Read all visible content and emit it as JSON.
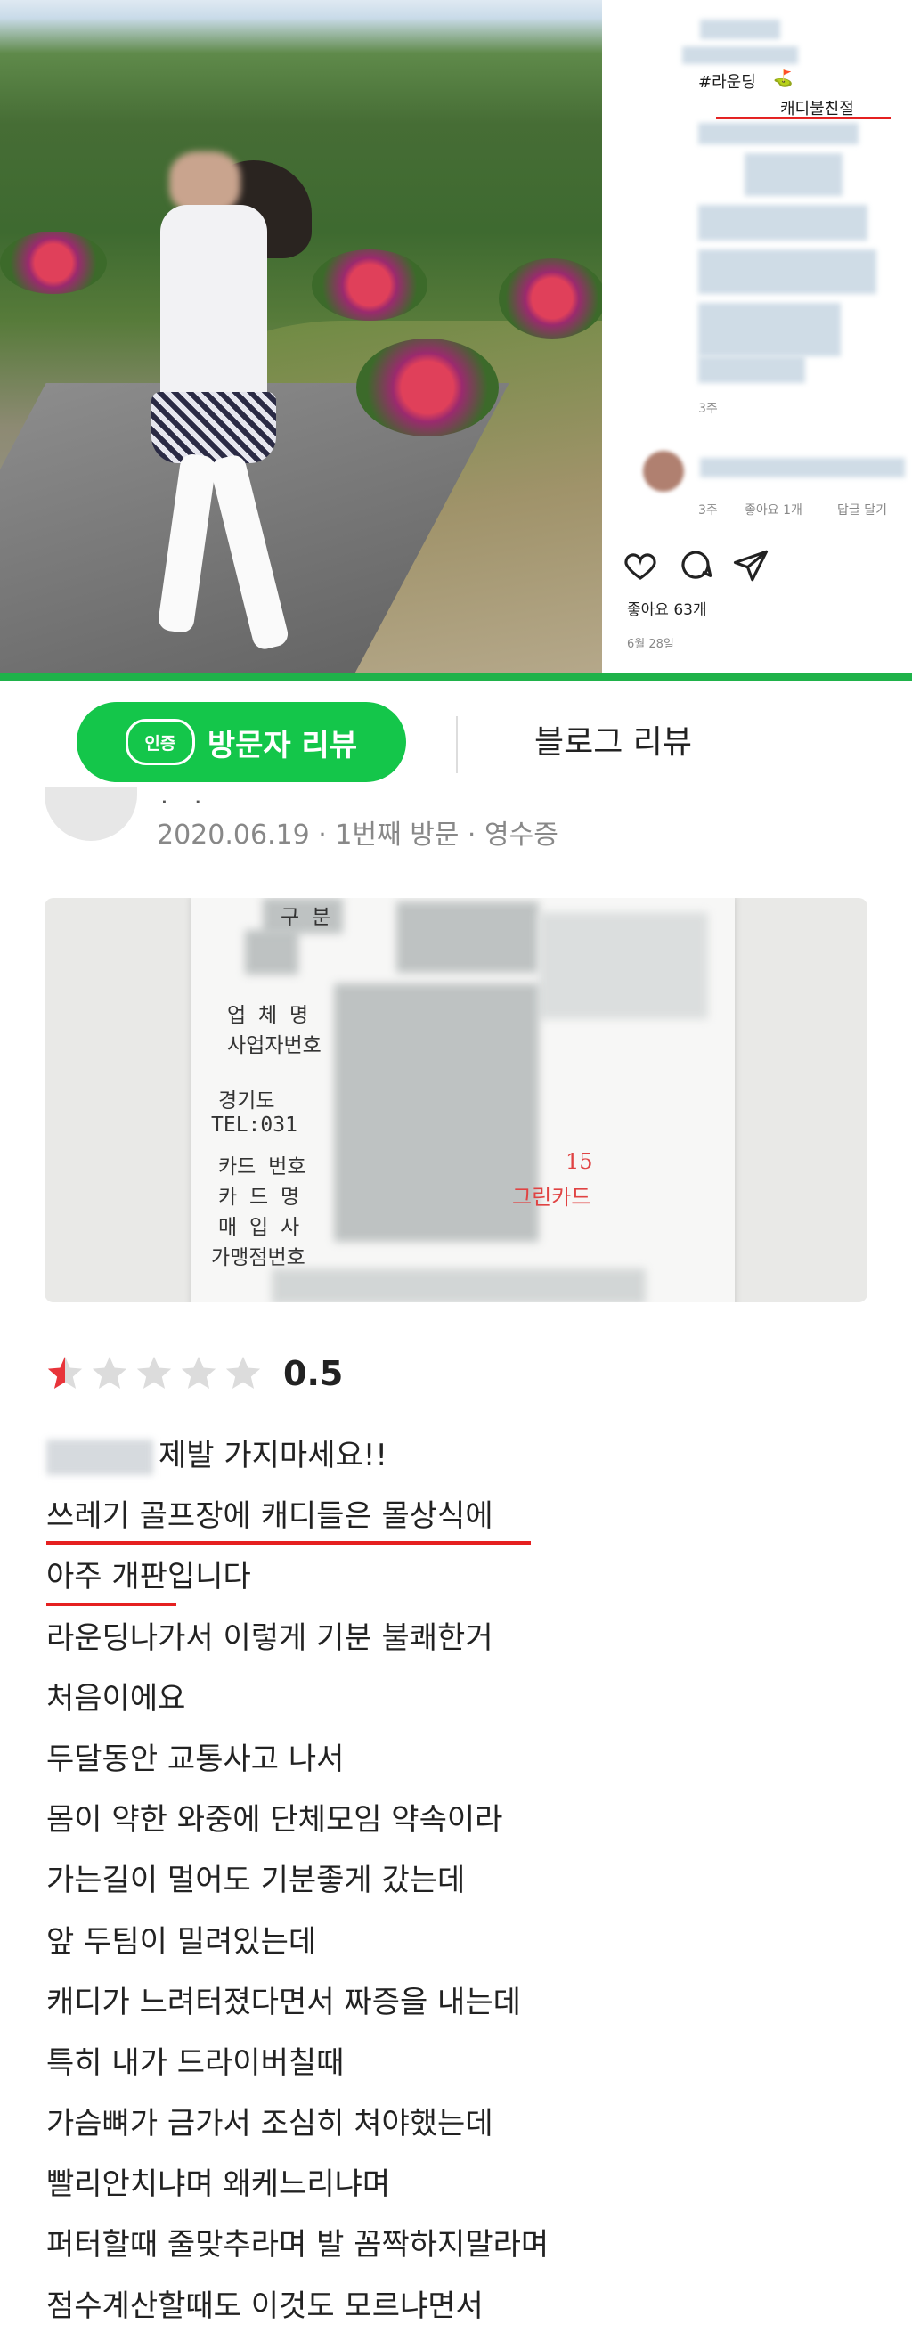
{
  "post": {
    "tags": [
      "#라운딩",
      "캐디불친절"
    ],
    "time_ago": "3주",
    "comment_time": "3주",
    "comment_likes": "좋아요 1개",
    "comment_reply": "답글 달기",
    "likes": "좋아요 63개",
    "date": "6월 28일",
    "icons": [
      "heart-icon",
      "comment-icon",
      "send-icon"
    ],
    "accent_underline": "#e52020"
  },
  "tabs": {
    "badge": "인증",
    "visitor_review": "방문자 리뷰",
    "blog_review": "블로그 리뷰",
    "active_color": "#14c64a"
  },
  "visit": {
    "dots": ". .",
    "info": "2020.06.19 · 1번째 방문 · 영수증"
  },
  "receipt": {
    "labels": [
      "구 분",
      "업 체 명",
      "사업자번호",
      "경기도",
      "TEL:031",
      "카드 번호",
      "카 드 명",
      "매 입 사",
      "가맹점번호"
    ],
    "handwritten": [
      "15",
      "그린카드"
    ]
  },
  "rating": {
    "stars_filled": 0.5,
    "stars_total": 5,
    "score": "0.5",
    "star_color": "#e8343a"
  },
  "review_lines": [
    "제발 가지마세요!!",
    "쓰레기 골프장에 캐디들은 몰상식에",
    "아주 개판입니다",
    "라운딩나가서 이렇게 기분 불쾌한거",
    "처음이에요",
    "두달동안 교통사고 나서",
    "몸이 약한 와중에 단체모임 약속이라",
    "가는길이 멀어도 기분좋게 갔는데",
    "앞 두팀이 밀려있는데",
    "캐디가 느려터졌다면서 짜증을 내는데",
    "특히 내가 드라이버칠때",
    "가슴뼈가 금가서 조심히 쳐야했는데",
    "빨리안치냐며 왜케느리냐며",
    "퍼터할때 줄맞추라며 발 꼼짝하지말라며",
    "점수계산할때도 이것도 모르냐면서"
  ]
}
